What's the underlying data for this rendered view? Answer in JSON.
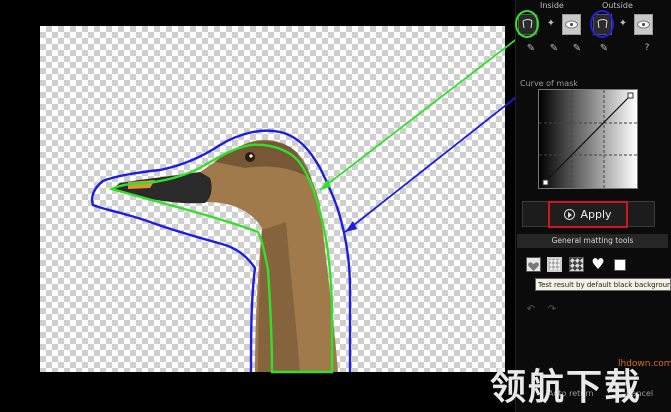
{
  "panel": {
    "inside_label": "Inside",
    "outside_label": "Outside",
    "help_label": "?",
    "curve_label": "Curve of mask",
    "apply_label": "Apply",
    "general_tools_label": "General matting tools",
    "tooltip": "Test result by default black background"
  },
  "watermark": {
    "text": "领航下载",
    "url": "lhdown.com"
  },
  "bottom": {
    "left_text": "Auto return",
    "right_text": "Cancel"
  },
  "colors": {
    "inside_stroke": "#32e02a",
    "outside_stroke": "#1d1ee0",
    "apply_highlight": "#d0161c"
  }
}
